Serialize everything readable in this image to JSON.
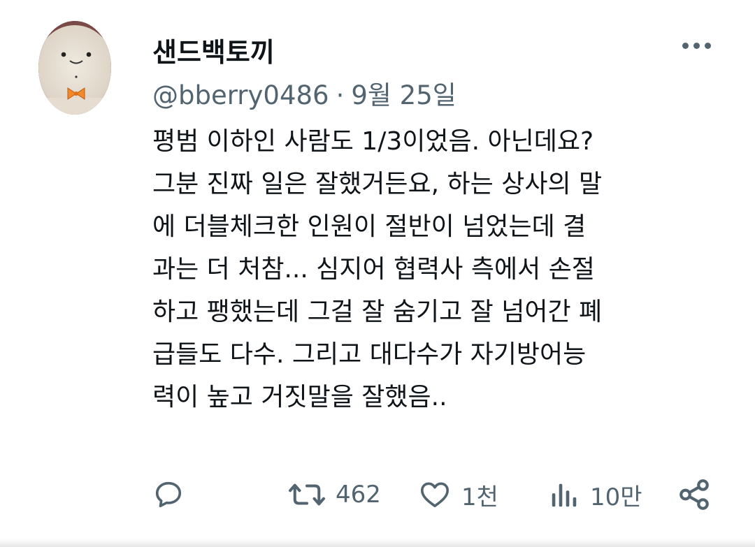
{
  "tweet": {
    "author": {
      "display_name": "샌드백토끼",
      "handle": "@bberry0486",
      "avatar_icon": "bunny-with-bowtie-avatar"
    },
    "separator": "·",
    "date": "9월 25일",
    "body_lines": [
      "평범 이하인 사람도 1/3이었음. 아닌데요?",
      "그분 진짜 일은 잘했거든요, 하는 상사의 말",
      "에 더블체크한 인원이 절반이 넘었는데 결",
      "과는 더 처참... 심지어 협력사 측에서 손절",
      "하고 팽했는데 그걸 잘 숨기고 잘 넘어간 폐",
      "급들도 다수. 그리고 대다수가 자기방어능",
      "력이 높고 거짓말을 잘했음.."
    ],
    "actions": {
      "reply": {
        "icon": "reply-icon",
        "count": ""
      },
      "retweet": {
        "icon": "retweet-icon",
        "count": "462"
      },
      "like": {
        "icon": "heart-icon",
        "count": "1천"
      },
      "views": {
        "icon": "views-icon",
        "count": "10만"
      },
      "share": {
        "icon": "share-icon"
      }
    },
    "more_icon": "more-icon"
  },
  "colors": {
    "text_primary": "#0f1419",
    "text_secondary": "#536471",
    "background": "#ffffff"
  }
}
